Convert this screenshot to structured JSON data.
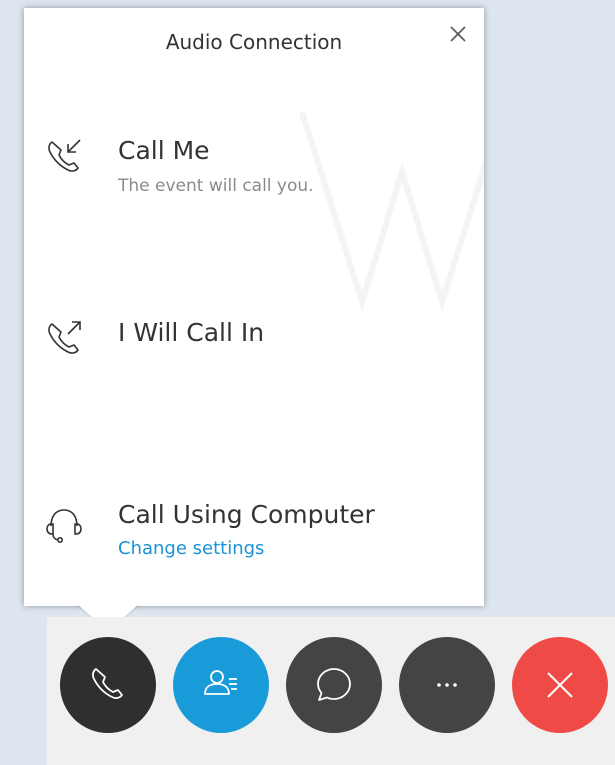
{
  "popup": {
    "title": "Audio Connection",
    "close_icon": "close-icon",
    "options": [
      {
        "icon": "incoming-call-icon",
        "label": "Call Me",
        "description": "The event will call you."
      },
      {
        "icon": "outgoing-call-icon",
        "label": "I Will Call In"
      },
      {
        "icon": "headset-icon",
        "label": "Call Using Computer",
        "link": "Change settings"
      }
    ]
  },
  "toolbar": {
    "buttons": [
      {
        "icon": "phone-icon",
        "color": "#2f2f2f"
      },
      {
        "icon": "participants-icon",
        "color": "#1a9bd9"
      },
      {
        "icon": "chat-icon",
        "color": "#444444"
      },
      {
        "icon": "more-icon",
        "color": "#444444"
      },
      {
        "icon": "leave-icon",
        "color": "#f04a46"
      }
    ]
  },
  "colors": {
    "link": "#1a92d4",
    "background": "#dde5ef"
  }
}
